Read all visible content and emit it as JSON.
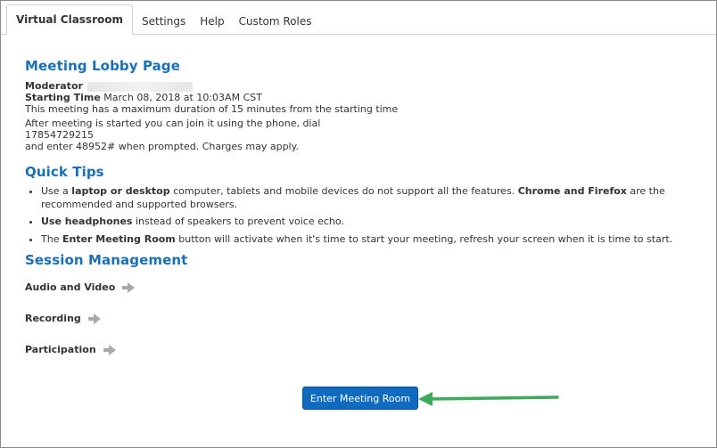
{
  "tabs": [
    {
      "label": "Virtual Classroom",
      "active": true
    },
    {
      "label": "Settings",
      "active": false
    },
    {
      "label": "Help",
      "active": false
    },
    {
      "label": "Custom Roles",
      "active": false
    }
  ],
  "lobby": {
    "title": "Meeting Lobby Page",
    "moderator_label": "Moderator",
    "starting_time_label": "Starting Time",
    "starting_time_value": "March 08, 2018 at 10:03AM CST",
    "duration_text": "This meeting has a maximum duration of 15 minutes from the starting time",
    "phone_text": "After meeting is started you can join it using the phone, dial",
    "phone_number": "17854729215",
    "enter_text": "and enter 48952# when prompted. Charges may apply."
  },
  "tips": {
    "title": "Quick Tips",
    "items": [
      {
        "p1": "Use a ",
        "b1": "laptop or desktop",
        "p2": " computer, tablets and mobile devices do not support all the features. ",
        "b2": "Chrome and Firefox",
        "p3": " are the recommended and supported browsers."
      },
      {
        "b1": "Use headphones",
        "p2": " instead of speakers to prevent voice echo."
      },
      {
        "p1": "The ",
        "b1": "Enter Meeting Room",
        "p2": " button will activate when it's time to start your meeting, refresh your screen when it is time to start."
      }
    ]
  },
  "session": {
    "title": "Session Management",
    "items": [
      {
        "label": "Audio and Video",
        "icon": "arrow-right-icon"
      },
      {
        "label": "Recording",
        "icon": "arrow-right-icon"
      },
      {
        "label": "Participation",
        "icon": "arrow-right-icon"
      }
    ]
  },
  "enter_button": {
    "label": "Enter Meeting Room"
  },
  "colors": {
    "heading": "#1a6fb5",
    "button": "#0f6bbf",
    "pointer_arrow": "#3daa5b"
  }
}
